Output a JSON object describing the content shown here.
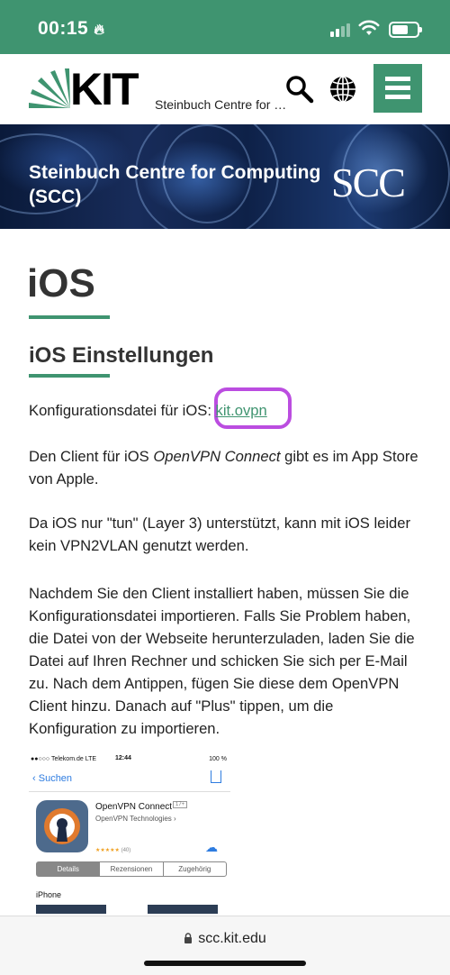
{
  "status_bar": {
    "time": "00:15",
    "colors": {
      "background": "#3f9470"
    }
  },
  "header": {
    "logo_text": "KIT",
    "site_name": "Steinbuch Centre for …",
    "icons": [
      "search-icon",
      "globe-icon",
      "menu-icon"
    ],
    "accent_color": "#3f9470"
  },
  "banner": {
    "title": "Steinbuch Centre for Computing (SCC)",
    "logo_text": "SCC"
  },
  "content": {
    "page_title": "iOS",
    "section_title": "iOS Einstellungen",
    "p1_prefix": "Konfigurationsdatei für iOS: ",
    "p1_link": "kit.ovpn",
    "p2_prefix": "Den Client für iOS ",
    "p2_em": "OpenVPN Connect",
    "p2_suffix": " gibt es im App Store von Apple.",
    "p3": "Da iOS nur \"tun\" (Layer 3) unterstützt, kann mit iOS leider kein VPN2VLAN genutzt werden.",
    "p4": "Nachdem Sie den Client installiert haben, müssen Sie die Konfigurationsdatei importieren. Falls Sie Problem haben, die Datei von der Webseite herunterzuladen, laden Sie die Datei auf Ihren Rechner und schicken Sie sich per E-Mail zu. Nach dem Antippen, fügen Sie diese dem OpenVPN Client hinzu. Danach auf \"Plus\" tippen, um die Konfiguration zu importieren."
  },
  "screenshot": {
    "carrier": "●●○○○ Telekom.de  LTE",
    "time": "12:44",
    "battery": "100 %",
    "back_label": "Suchen",
    "app_name": "OpenVPN Connect",
    "age_rating": "17+",
    "developer": "OpenVPN Technologies",
    "rating_stars": "★★★★★",
    "rating_count": "(40)",
    "tabs": [
      "Details",
      "Rezensionen",
      "Zugehörig"
    ],
    "section": "iPhone"
  },
  "url_bar": {
    "url": "scc.kit.edu"
  }
}
